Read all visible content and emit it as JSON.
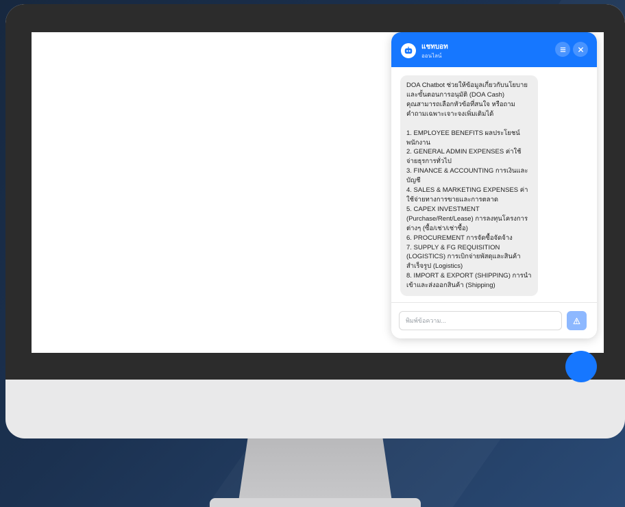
{
  "chat": {
    "header": {
      "title": "แชทบอท",
      "status": "ออนไลน์",
      "icons": [
        "bot-avatar-icon",
        "menu-icon",
        "close-icon"
      ]
    },
    "message": {
      "intro_1": "DOA Chatbot ช่วยให้ข้อมูลเกี่ยวกับนโยบายและขั้นตอนการอนุมัติ (DOA Cash)",
      "intro_2": "คุณสามารถเลือกหัวข้อที่สนใจ หรือถามคำถามเฉพาะเจาะจงเพิ่มเติมได้",
      "items": [
        "1. EMPLOYEE BENEFITS ผลประโยชน์พนักงาน",
        "2. GENERAL ADMIN EXPENSES ค่าใช้จ่ายธุรการทั่วไป",
        "3. FINANCE & ACCOUNTING การเงินและบัญชี",
        "4. SALES & MARKETING EXPENSES ค่าใช้จ่ายทางการขายและการตลาด",
        "5. CAPEX INVESTMENT (Purchase/Rent/Lease) การลงทุนโครงการต่างๆ (ซื้อ/เช่า/เช่าซื้อ)",
        "6. PROCUREMENT การจัดซื้อจัดจ้าง",
        "7. SUPPLY & FG REQUISITION (LOGISTICS) การเบิกจ่ายพัสดุและสินค้าสำเร็จรูป (Logistics)",
        "8. IMPORT & EXPORT (SHIPPING) การนำเข้าและส่งออกสินค้า (Shipping)"
      ]
    },
    "input": {
      "placeholder": "พิมพ์ข้อความ...",
      "value": ""
    },
    "send_icon": "send-icon"
  },
  "colors": {
    "accent": "#1677ff",
    "send_button": "#8db8ff",
    "bubble": "#eeeeee",
    "bezel": "#2c2c2c",
    "background": "#1b3150"
  }
}
